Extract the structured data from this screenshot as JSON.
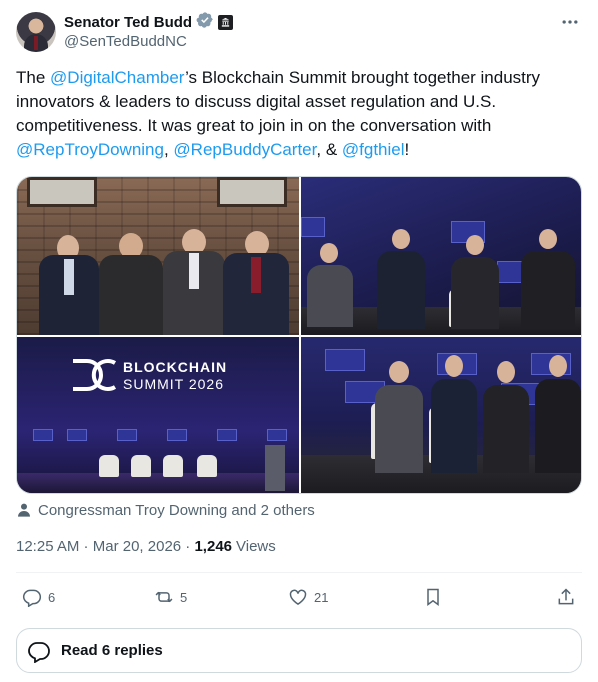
{
  "author": {
    "display_name": "Senator Ted Budd",
    "handle": "@SenTedBuddNC",
    "verified_icon": "verified-badge-icon",
    "affiliation_icon": "government-affiliation-icon"
  },
  "tweet": {
    "text_1": "The ",
    "mention_1": "@DigitalChamber",
    "text_2": "’s Blockchain Summit brought together industry innovators & leaders to discuss digital asset regulation and U.S. competitiveness. It was great to join in on the conversation with ",
    "mention_2": "@RepTroyDowning",
    "text_3": ", ",
    "mention_3": "@RepBuddyCarter",
    "text_4": ", & ",
    "mention_4": "@fgthiel",
    "text_5": "!"
  },
  "media": {
    "photo_3_logo_line1": "BLOCKCHAIN",
    "photo_3_logo_line2": "SUMMIT 2026"
  },
  "tagged": {
    "text": "Congressman Troy Downing and 2 others"
  },
  "meta": {
    "time": "12:25 AM",
    "separator": " · ",
    "date": "Mar 20, 2026",
    "separator2": " · ",
    "views_count": "1,246",
    "views_label": "Views"
  },
  "actions": {
    "replies": "6",
    "reposts": "5",
    "likes": "21"
  },
  "read_replies": {
    "label": "Read 6 replies"
  },
  "colors": {
    "link": "#1d9bf0",
    "secondary_text": "#536471",
    "primary_text": "#0f1419",
    "border": "#cfd9de"
  }
}
